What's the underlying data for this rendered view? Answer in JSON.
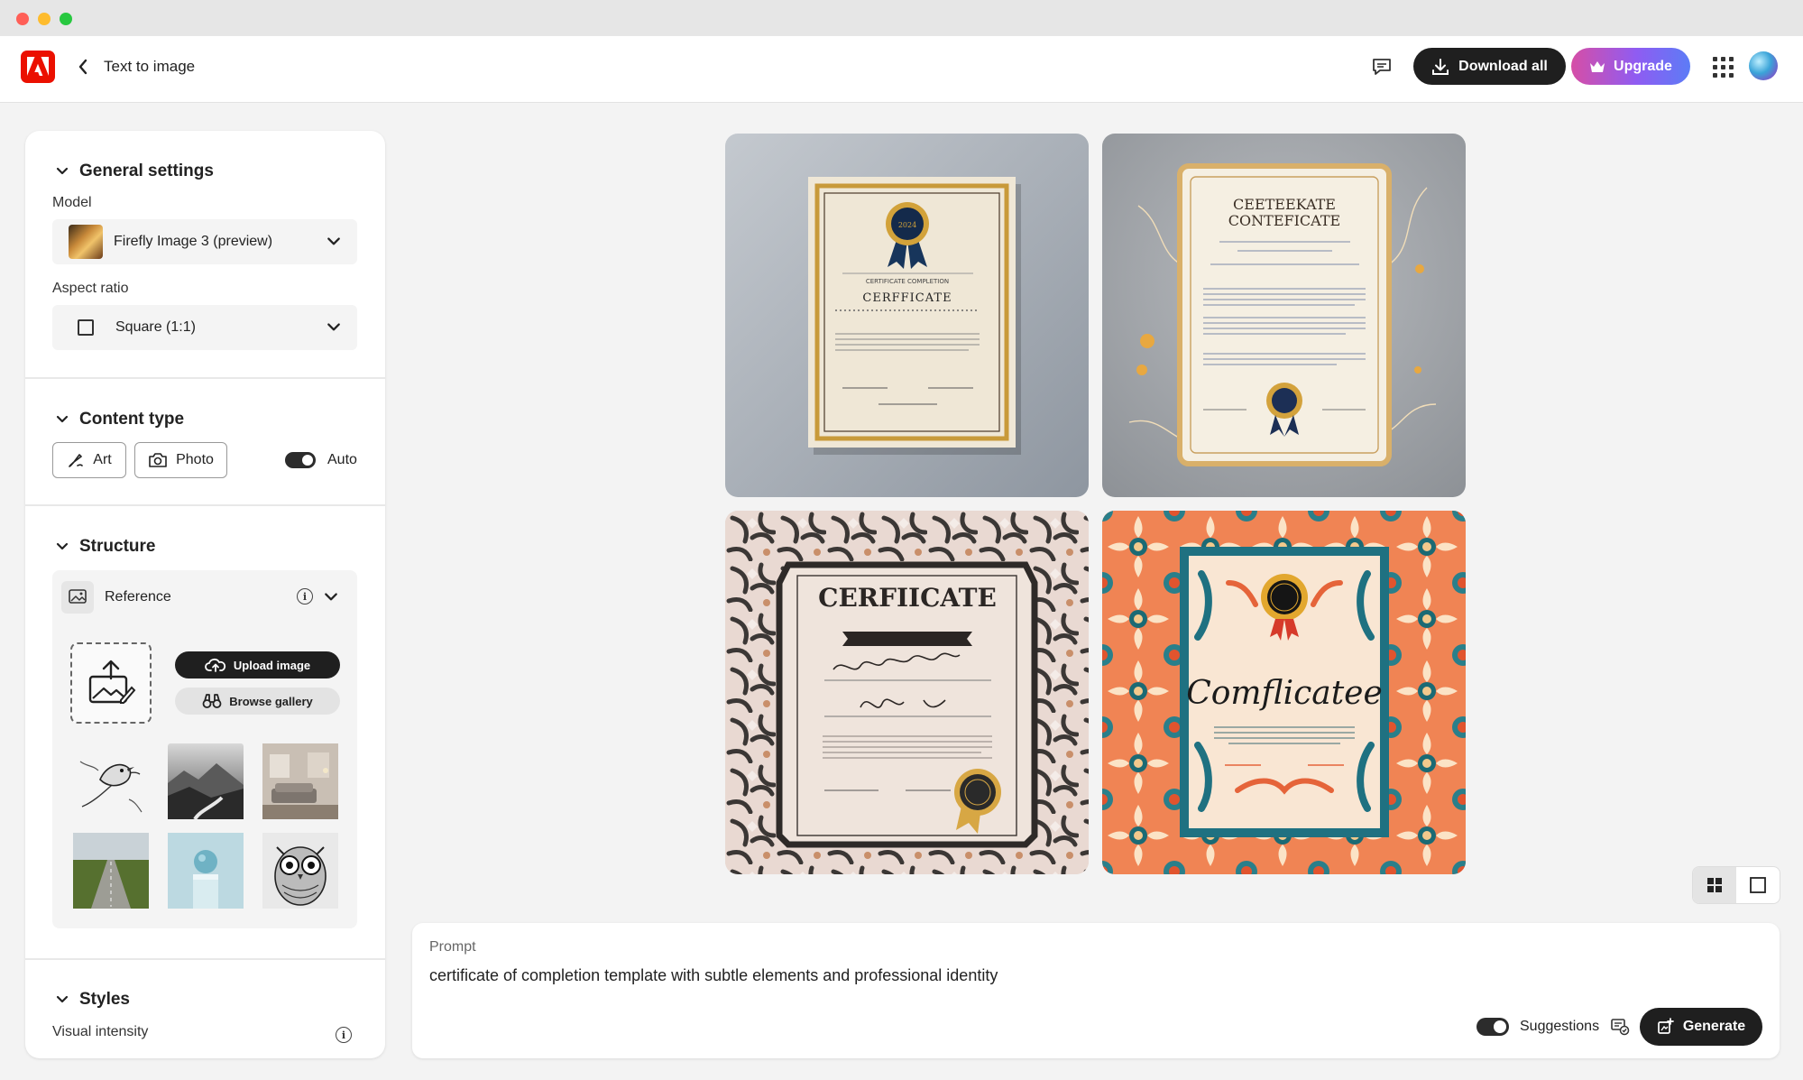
{
  "window": {
    "traffic_colors": [
      "#ff5f57",
      "#febc2e",
      "#28c840"
    ]
  },
  "header": {
    "app_title": "Text to image",
    "download_label": "Download all",
    "upgrade_label": "Upgrade",
    "brand_color": "#eb1000"
  },
  "sidebar": {
    "general": {
      "title": "General settings",
      "model_label": "Model",
      "model_value": "Firefly Image 3 (preview)",
      "aspect_label": "Aspect ratio",
      "aspect_value": "Square (1:1)"
    },
    "content_type": {
      "title": "Content type",
      "art_label": "Art",
      "photo_label": "Photo",
      "auto_label": "Auto"
    },
    "structure": {
      "title": "Structure",
      "reference_label": "Reference",
      "upload_label": "Upload image",
      "gallery_label": "Browse gallery",
      "thumbnails": [
        "bird-sketch",
        "mountain-river",
        "living-room",
        "green-field-road",
        "sphere-on-block",
        "owl-sketch"
      ]
    },
    "styles": {
      "title": "Styles",
      "intensity_label": "Visual intensity"
    }
  },
  "gallery": {
    "images": [
      {
        "name": "certificate-classic-gray",
        "title": "CERFFICATE",
        "subtitle": "CERTIFICATE COMPLETION"
      },
      {
        "name": "certificate-gold-frame",
        "title": "CEETEEKATE CONTEFICATE",
        "subtitle": ""
      },
      {
        "name": "certificate-floral-pink",
        "title": "CERFIICATE",
        "subtitle": ""
      },
      {
        "name": "certificate-orange-pattern",
        "title": "Comflicatee",
        "subtitle": ""
      }
    ]
  },
  "prompt": {
    "label": "Prompt",
    "text": "certificate of completion template with subtle elements and professional identity",
    "suggestions_label": "Suggestions",
    "generate_label": "Generate"
  }
}
